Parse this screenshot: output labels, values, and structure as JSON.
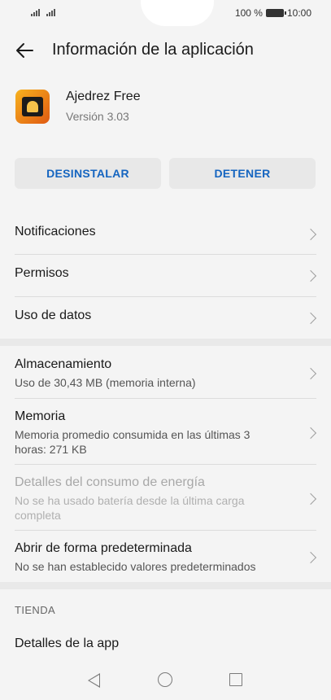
{
  "status_bar": {
    "battery_pct": "100 %",
    "time": "10:00"
  },
  "app_bar": {
    "title": "Información de la aplicación"
  },
  "app": {
    "name": "Ajedrez Free",
    "version": "Versión 3.03"
  },
  "buttons": {
    "uninstall": "DESINSTALAR",
    "stop": "DETENER"
  },
  "rows_basic": [
    {
      "label": "Notificaciones"
    },
    {
      "label": "Permisos"
    },
    {
      "label": "Uso de datos"
    }
  ],
  "rows_detail": [
    {
      "label": "Almacenamiento",
      "sub": "Uso de 30,43 MB (memoria interna)"
    },
    {
      "label": "Memoria",
      "sub": "Memoria promedio consumida en las últimas 3 horas: 271 KB"
    },
    {
      "label": "Detalles del consumo de energía",
      "sub": "No se ha usado batería desde la última carga completa"
    },
    {
      "label": "Abrir de forma predeterminada",
      "sub": "No se han establecido valores predeterminados"
    }
  ],
  "store": {
    "header": "TIENDA",
    "details_label": "Detalles de la app"
  }
}
